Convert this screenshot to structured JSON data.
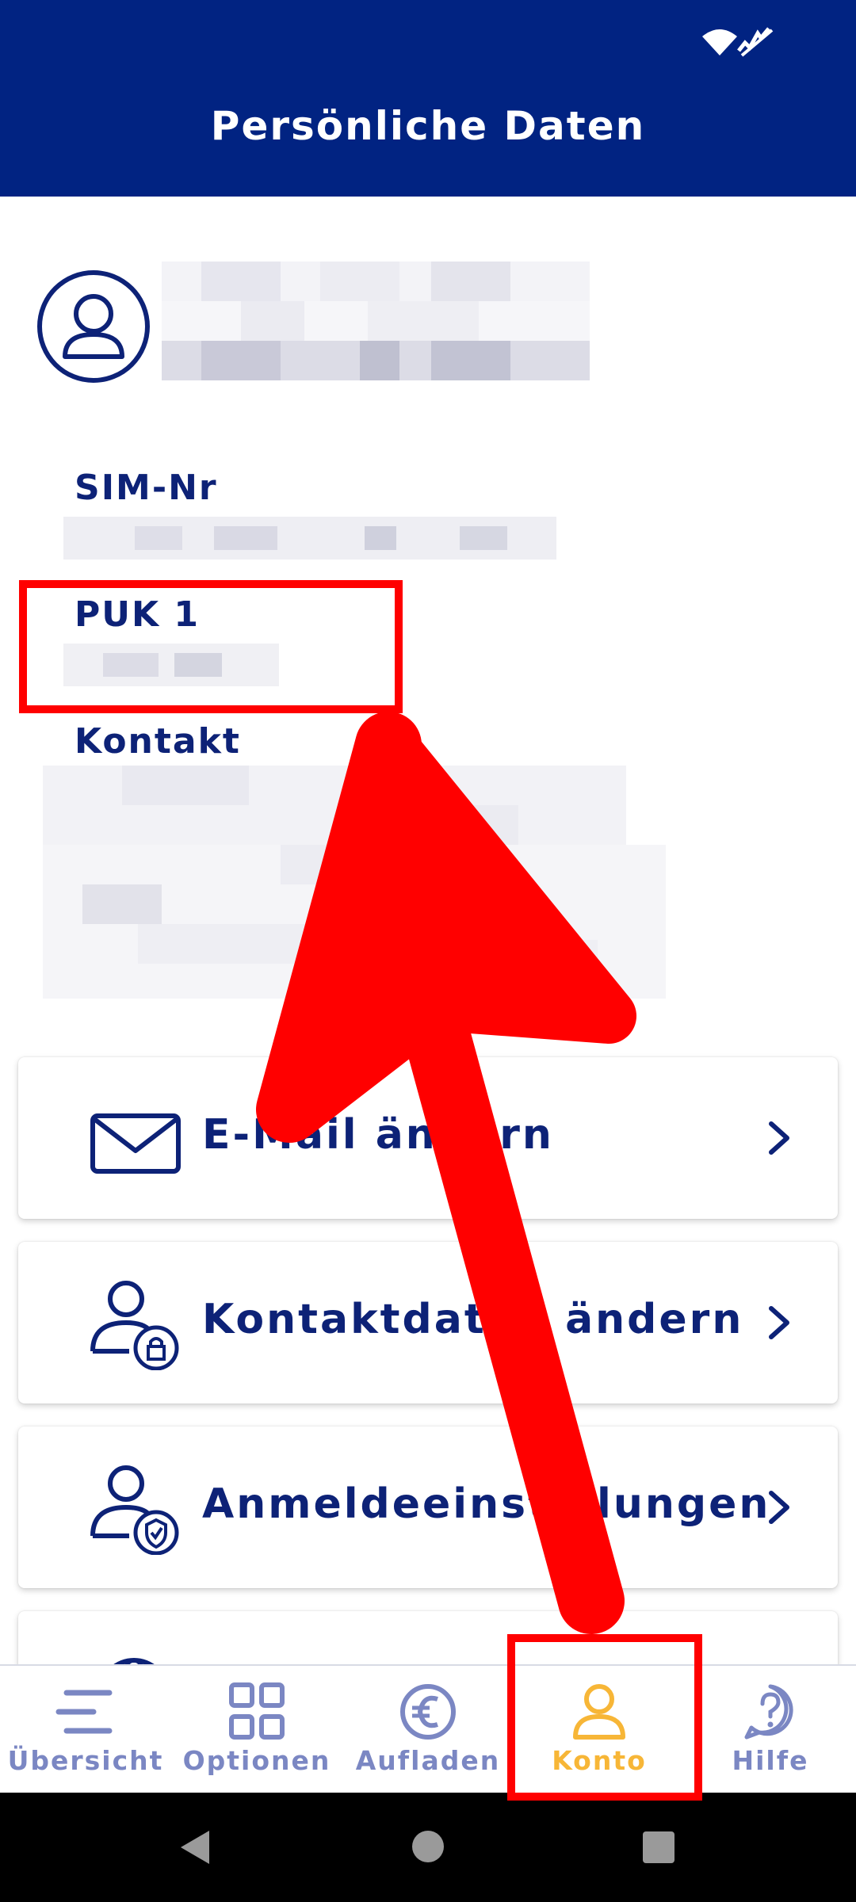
{
  "header": {
    "title": "Persönliche Daten"
  },
  "profile": {
    "sim_label": "SIM-Nr",
    "puk_label": "PUK 1",
    "contact_label": "Kontakt"
  },
  "menu": [
    {
      "label": "E-Mail ändern",
      "icon": "mail-icon"
    },
    {
      "label": "Kontaktdaten ändern",
      "icon": "user-lock-icon"
    },
    {
      "label": "Anmeldeeinstellungen",
      "icon": "user-shield-icon"
    }
  ],
  "bottom_nav": [
    {
      "label": "Übersicht",
      "icon": "menu-lines-icon"
    },
    {
      "label": "Optionen",
      "icon": "grid-icon"
    },
    {
      "label": "Aufladen",
      "icon": "euro-icon"
    },
    {
      "label": "Konto",
      "icon": "user-icon",
      "active": true
    },
    {
      "label": "Hilfe",
      "icon": "help-icon"
    }
  ],
  "colors": {
    "brand": "#012382",
    "text": "#0d2277",
    "nav_inactive": "#7b87c3",
    "nav_active": "#f7b637",
    "annotation": "#ff0000"
  }
}
